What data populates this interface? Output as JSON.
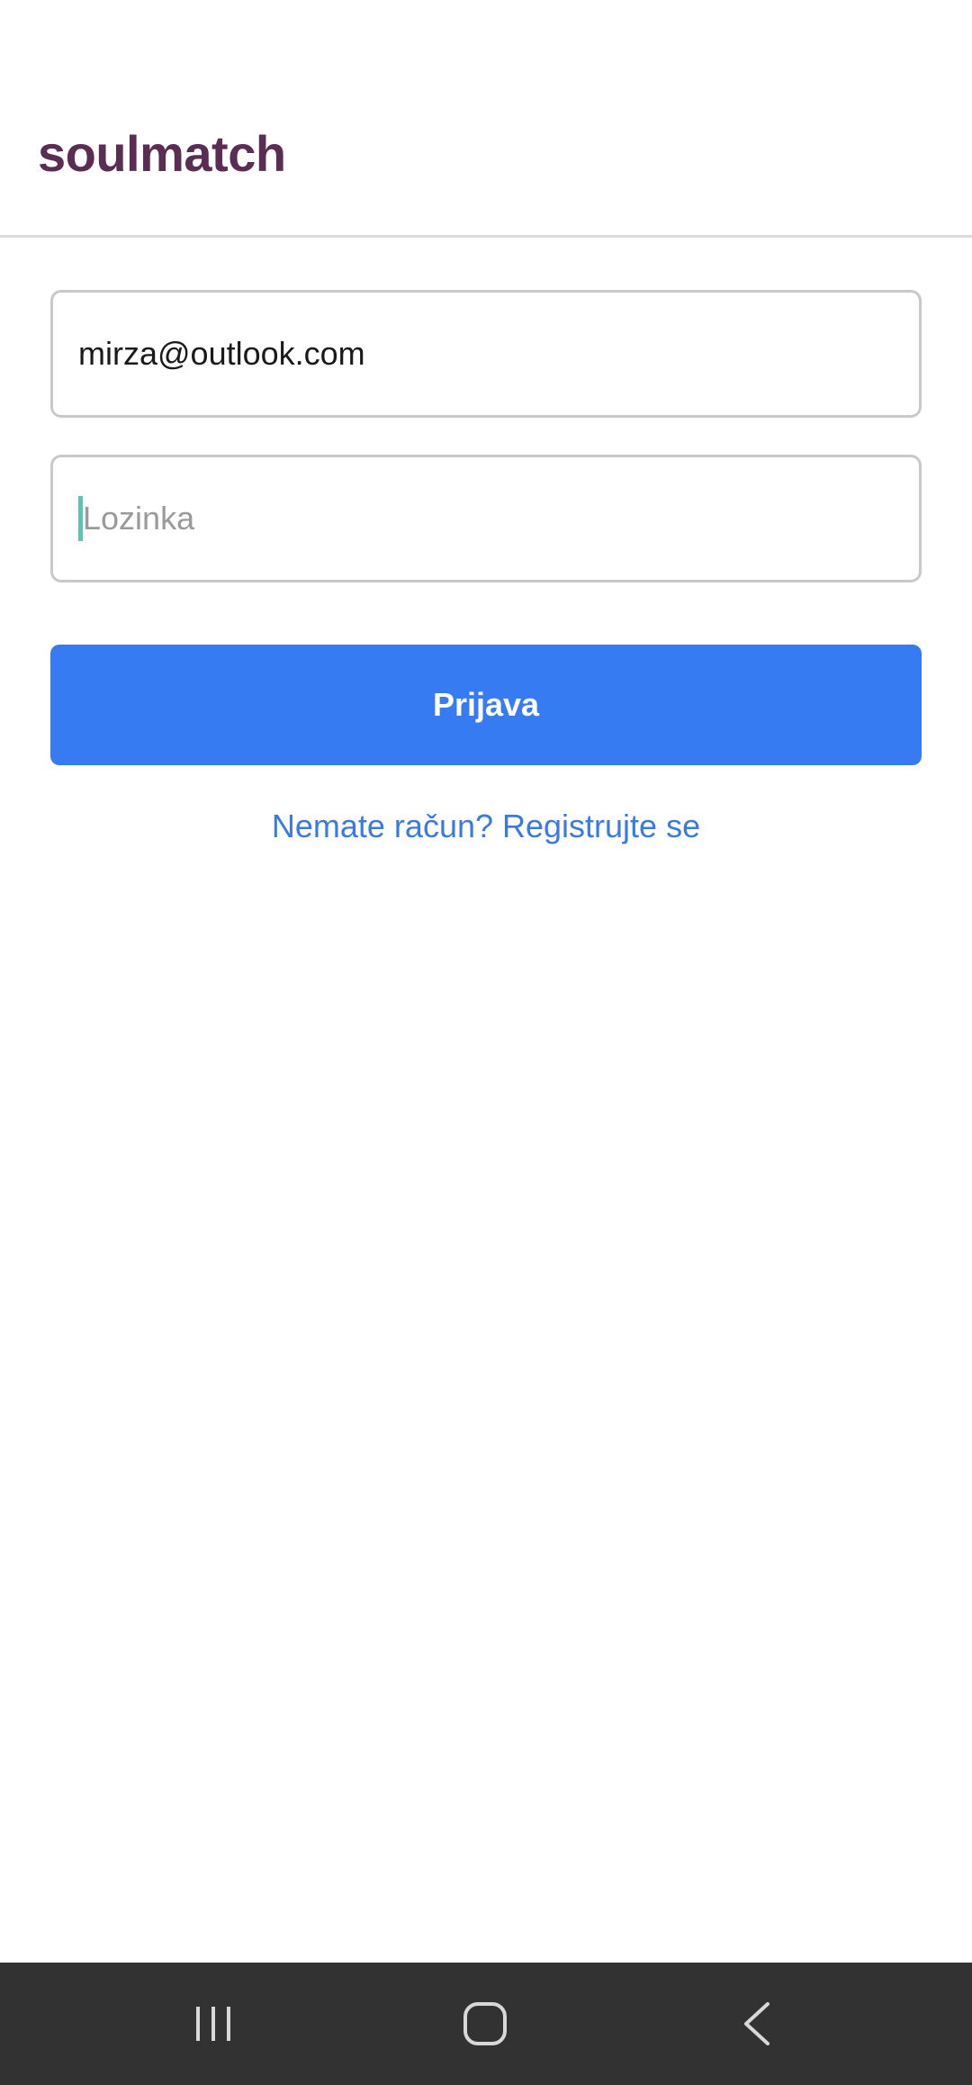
{
  "header": {
    "title": "soulmatch",
    "title_color": "#5a2d52"
  },
  "form": {
    "email_value": "mirza@outlook.com",
    "password_placeholder": "Lozinka",
    "login_label": "Prijava",
    "login_color": "#377bf3",
    "register_link": "Nemate račun? Registrujte se",
    "link_color": "#3a7be0"
  },
  "nav_bar": {
    "background": "#323232",
    "buttons": [
      "recent-apps-icon",
      "home-icon",
      "back-icon"
    ]
  }
}
